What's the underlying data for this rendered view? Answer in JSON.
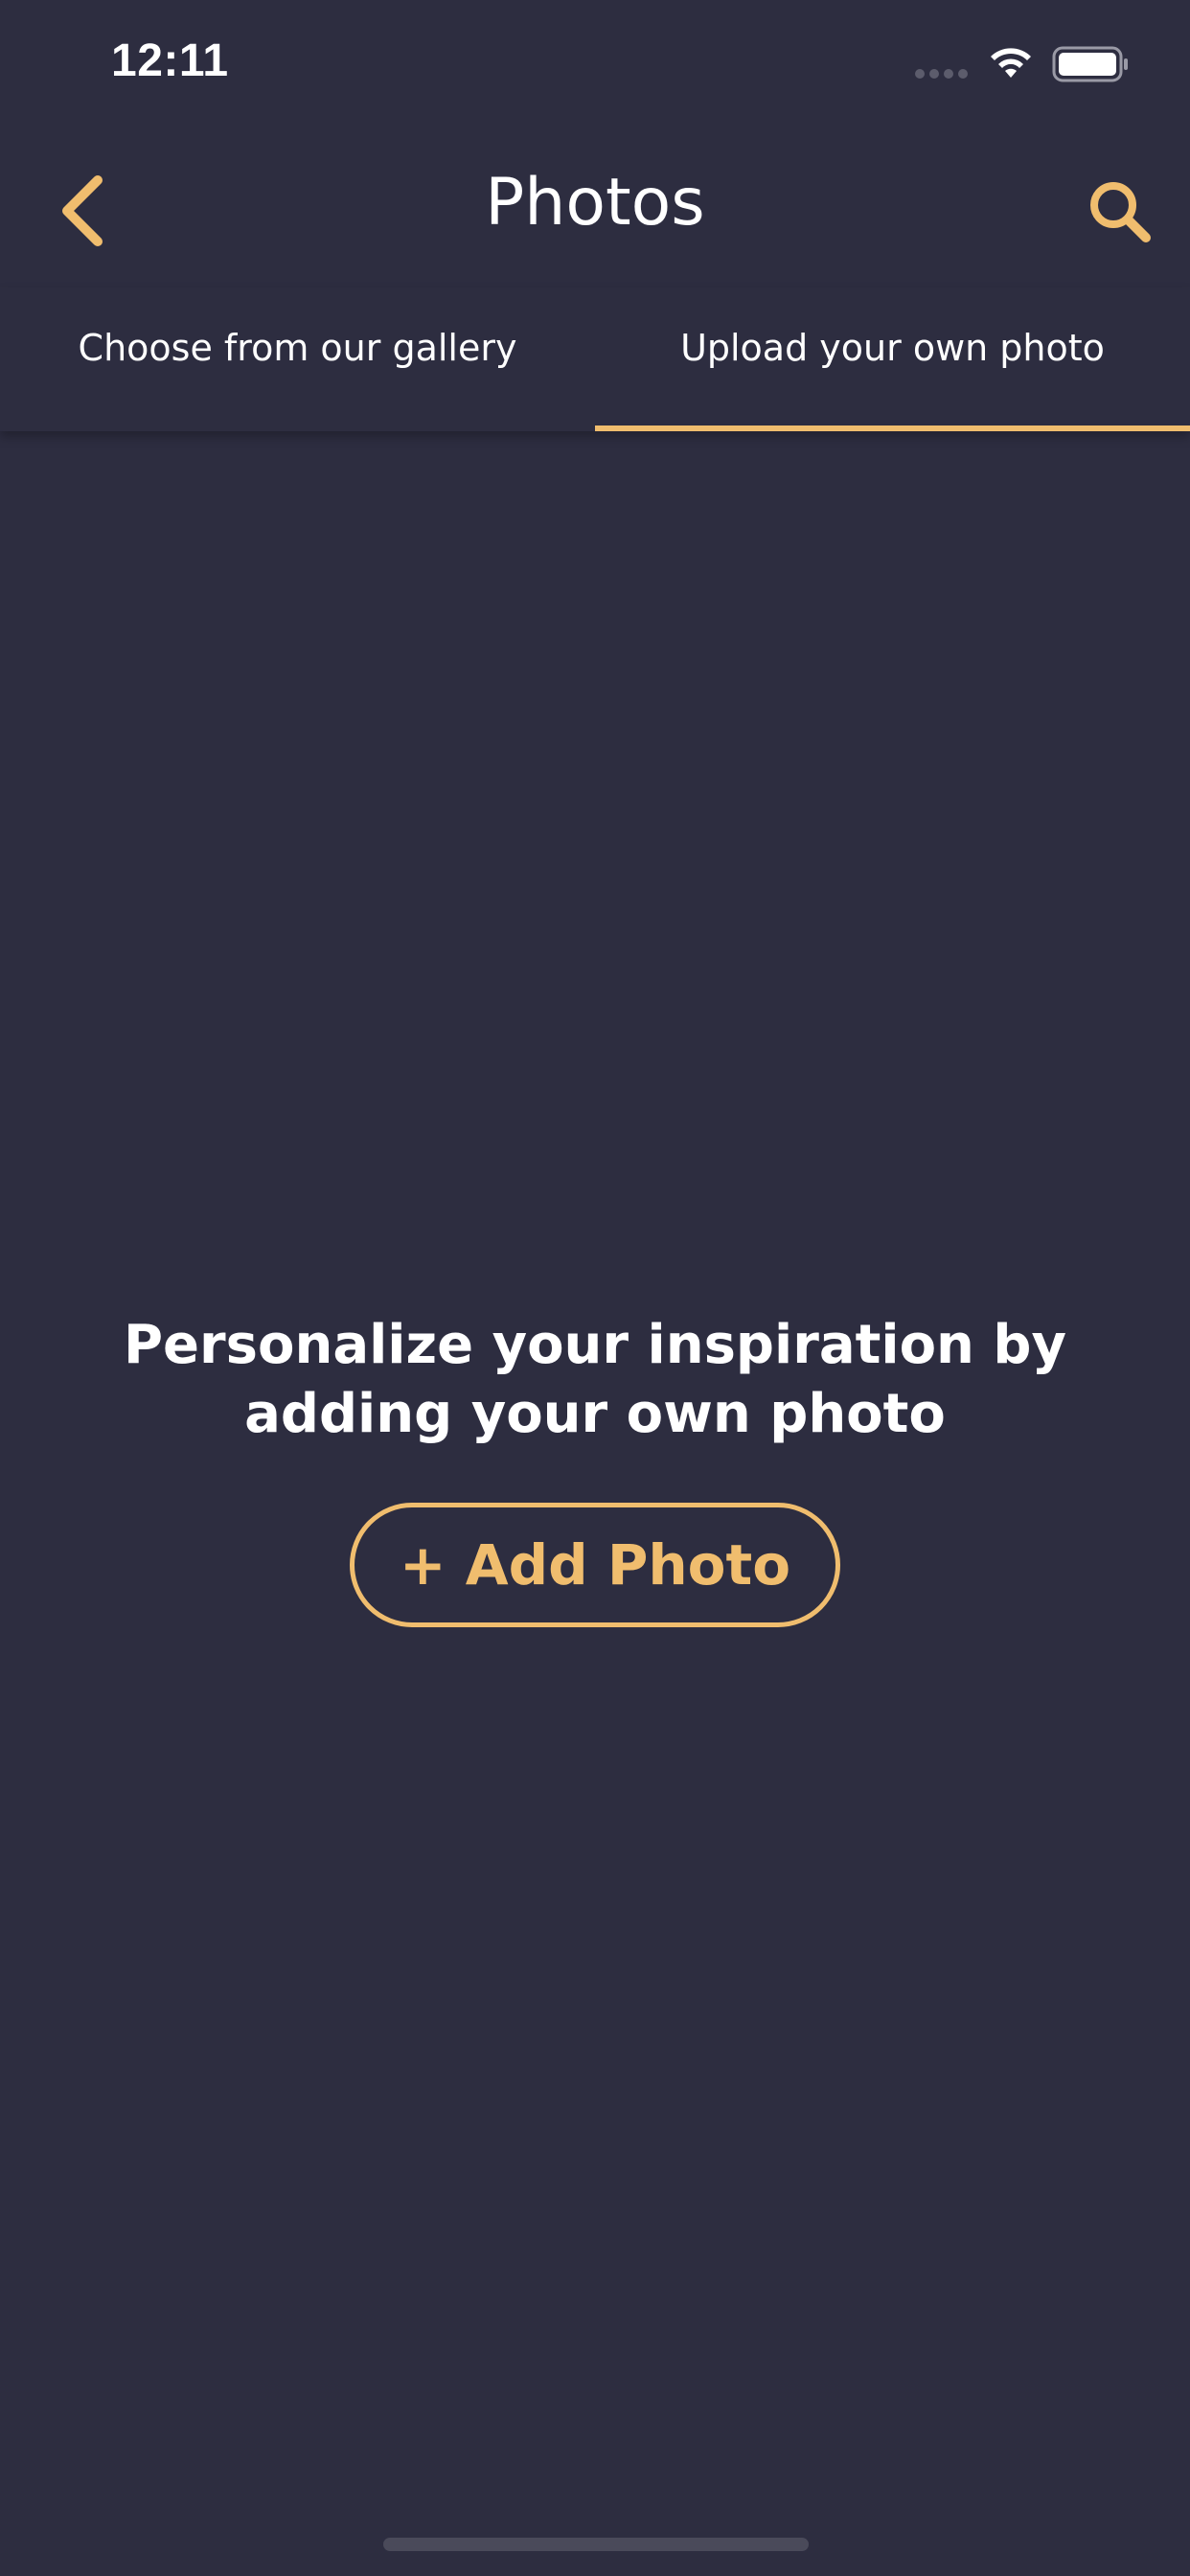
{
  "status_bar": {
    "time": "12:11"
  },
  "header": {
    "title": "Photos",
    "back_icon": "chevron-left-icon",
    "search_icon": "search-icon"
  },
  "tabs": [
    {
      "label": "Choose from our gallery",
      "active": false
    },
    {
      "label": "Upload your own photo",
      "active": true
    }
  ],
  "main": {
    "message": "Personalize your inspiration by adding your own photo",
    "add_photo_label": "+ Add Photo"
  },
  "colors": {
    "background": "#2d2d40",
    "accent": "#f0bd6e",
    "text": "#ffffff"
  }
}
